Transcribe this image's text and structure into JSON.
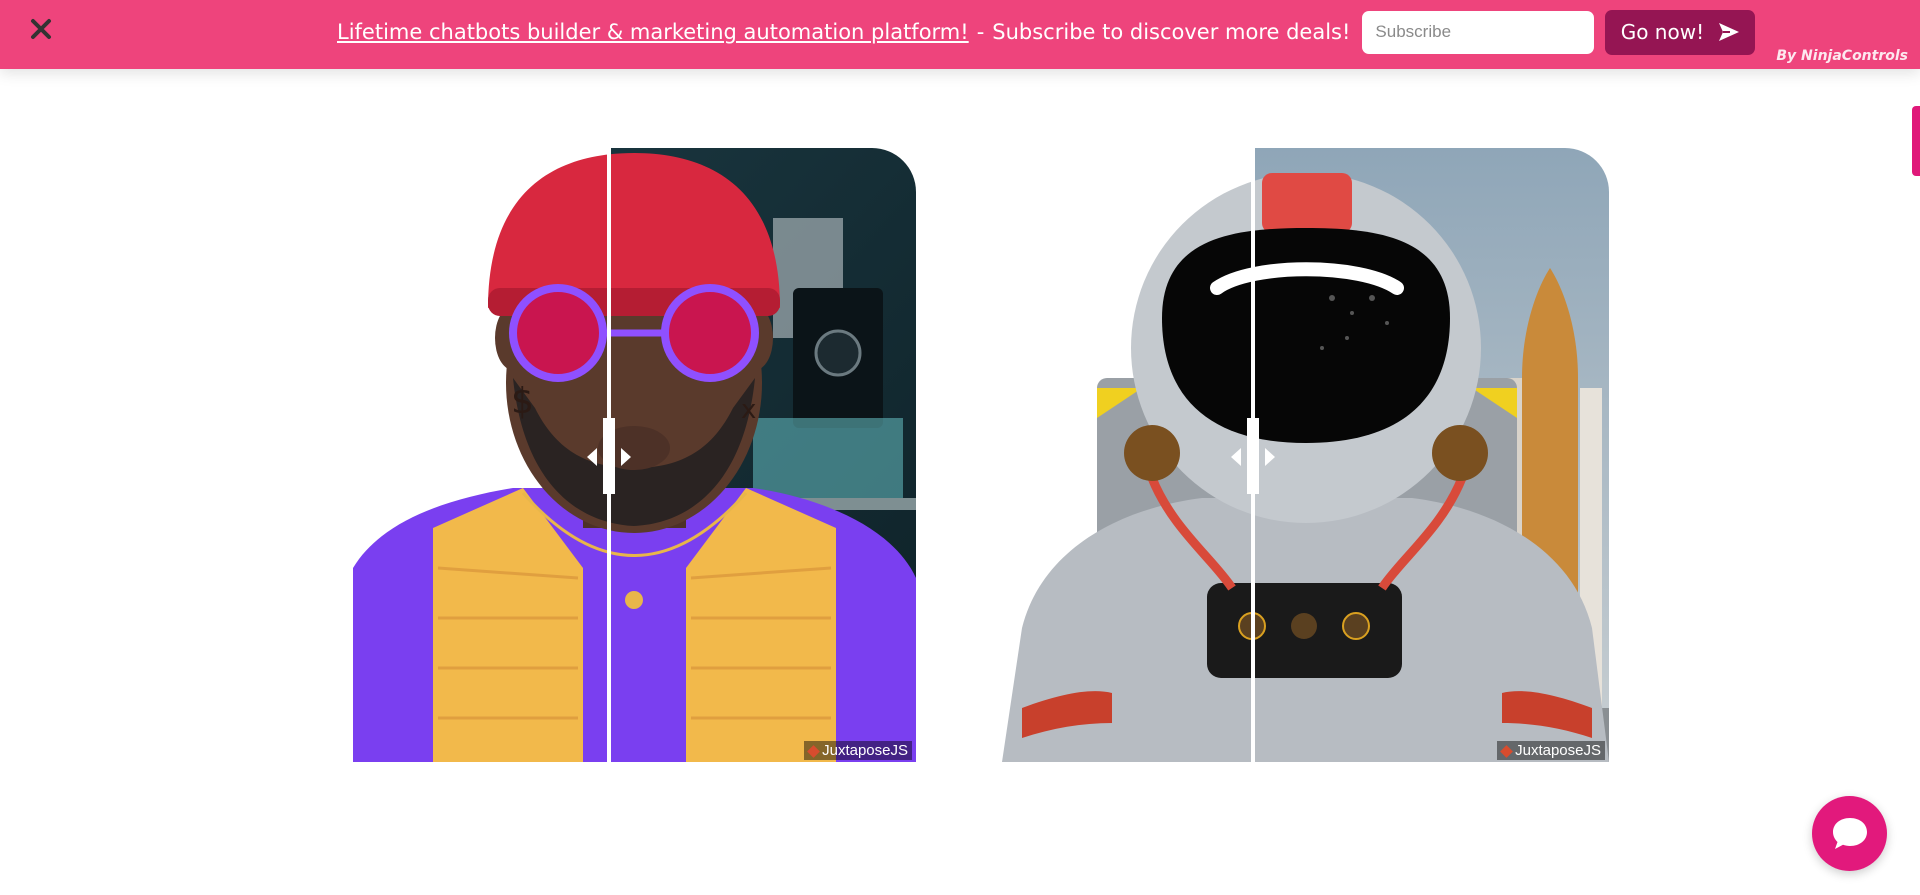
{
  "promo": {
    "link_text": "Lifetime chatbots builder & marketing automation platform!",
    "separator": "-",
    "tagline": "Subscribe to discover more deals!",
    "input_placeholder": "Subscribe",
    "input_value": "",
    "button_label": "Go now!",
    "credit": "By NinjaControls",
    "colors": {
      "bar": "#ee447c",
      "button": "#951553"
    }
  },
  "sliders": [
    {
      "credit": "JuxtaposeJS",
      "handle_position_percent": 45.5
    },
    {
      "credit": "JuxtaposeJS",
      "handle_position_percent": 41.3
    }
  ],
  "chat": {
    "icon": "chat-bubble-icon",
    "color": "#e2197c"
  },
  "icons": {
    "close": "close-icon",
    "send": "send-icon",
    "arrow_left": "arrow-left-icon",
    "arrow_right": "arrow-right-icon"
  }
}
